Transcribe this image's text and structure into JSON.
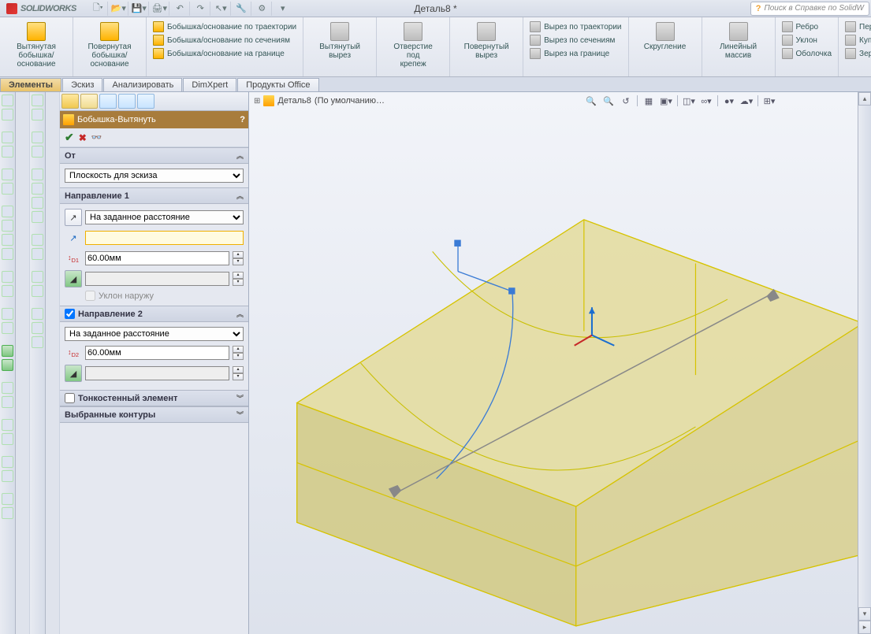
{
  "app_name": "SOLIDWORKS",
  "doc_title": "Деталь8 *",
  "search_placeholder": "Поиск в Справке по SolidW",
  "ribbon": {
    "boss_extrude": "Вытянутая\nбобышка/основание",
    "boss_revolve": "Повернутая\nбобышка/основание",
    "boss_sweep": "Бобышка/основание по траектории",
    "boss_loft": "Бобышка/основание по сечениям",
    "boss_boundary": "Бобышка/основание на границе",
    "cut_extrude": "Вытянутый\nвырез",
    "hole_wizard": "Отверстие\nпод\nкрепеж",
    "cut_revolve": "Повернутый\nвырез",
    "cut_sweep": "Вырез по траектории",
    "cut_loft": "Вырез по сечениям",
    "cut_boundary": "Вырез на границе",
    "fillet": "Скругление",
    "linear_pattern": "Линейный\nмассив",
    "rib": "Ребро",
    "draft": "Уклон",
    "shell": "Оболочка",
    "move": "Перенос",
    "dome": "Купол",
    "mirror": "Зеркальное о"
  },
  "tabs": [
    "Элементы",
    "Эскиз",
    "Анализировать",
    "DimXpert",
    "Продукты Office"
  ],
  "active_tab": 0,
  "pm": {
    "title": "Бобышка-Вытянуть",
    "from_hdr": "От",
    "from_dd": "Плоскость для эскиза",
    "dir1_hdr": "Направление 1",
    "dir1_dd": "На заданное расстояние",
    "dir1_depth": "60.00мм",
    "draft_out": "Уклон наружу",
    "dir2_hdr": "Направление 2",
    "dir2_dd": "На заданное расстояние",
    "dir2_depth": "60.00мм",
    "thin_hdr": "Тонкостенный элемент",
    "sel_contours_hdr": "Выбранные контуры"
  },
  "breadcrumb": {
    "doc": "Деталь8",
    "config": "(По умолчанию…"
  }
}
